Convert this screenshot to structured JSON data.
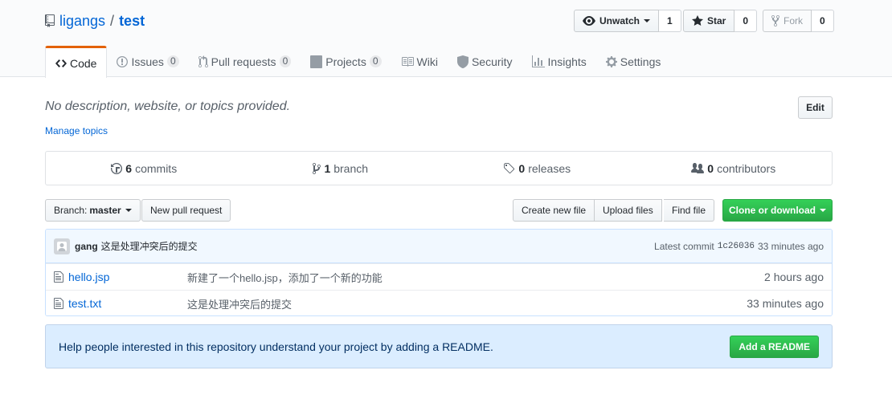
{
  "repo": {
    "owner": "ligangs",
    "separator": "/",
    "name": "test"
  },
  "actions": {
    "watch_label": "Unwatch",
    "watch_count": "1",
    "star_label": "Star",
    "star_count": "0",
    "fork_label": "Fork",
    "fork_count": "0"
  },
  "tabs": [
    {
      "label": "Code",
      "icon": "code-icon",
      "selected": true
    },
    {
      "label": "Issues",
      "count": "0",
      "icon": "issue-icon"
    },
    {
      "label": "Pull requests",
      "count": "0",
      "icon": "pull-request-icon"
    },
    {
      "label": "Projects",
      "count": "0",
      "icon": "project-icon"
    },
    {
      "label": "Wiki",
      "icon": "book-icon"
    },
    {
      "label": "Security",
      "icon": "shield-icon"
    },
    {
      "label": "Insights",
      "icon": "graph-icon"
    },
    {
      "label": "Settings",
      "icon": "gear-icon"
    }
  ],
  "description": "No description, website, or topics provided.",
  "manage_topics": "Manage topics",
  "edit_label": "Edit",
  "summary": {
    "commits_num": "6",
    "commits_label": "commits",
    "branch_num": "1",
    "branch_label": "branch",
    "releases_num": "0",
    "releases_label": "releases",
    "contributors_num": "0",
    "contributors_label": "contributors"
  },
  "filebar": {
    "branch_prefix": "Branch:",
    "branch_name": "master",
    "new_pr": "New pull request",
    "create_file": "Create new file",
    "upload_files": "Upload files",
    "find_file": "Find file",
    "clone": "Clone or download"
  },
  "latest_commit": {
    "author": "gang",
    "message": "这是处理冲突后的提交",
    "prefix": "Latest commit",
    "sha": "1c26036",
    "age": "33 minutes ago"
  },
  "files": [
    {
      "name": "hello.jsp",
      "message": "新建了一个hello.jsp，添加了一个新的功能",
      "age": "2 hours ago"
    },
    {
      "name": "test.txt",
      "message": "这是处理冲突后的提交",
      "age": "33 minutes ago"
    }
  ],
  "readme": {
    "text": "Help people interested in this repository understand your project by adding a README.",
    "button": "Add a README"
  },
  "colors": {
    "accent": "#0366d6",
    "tab_active": "#e36209",
    "primary_green": "#28a745",
    "readme_bg": "#dbedff"
  }
}
